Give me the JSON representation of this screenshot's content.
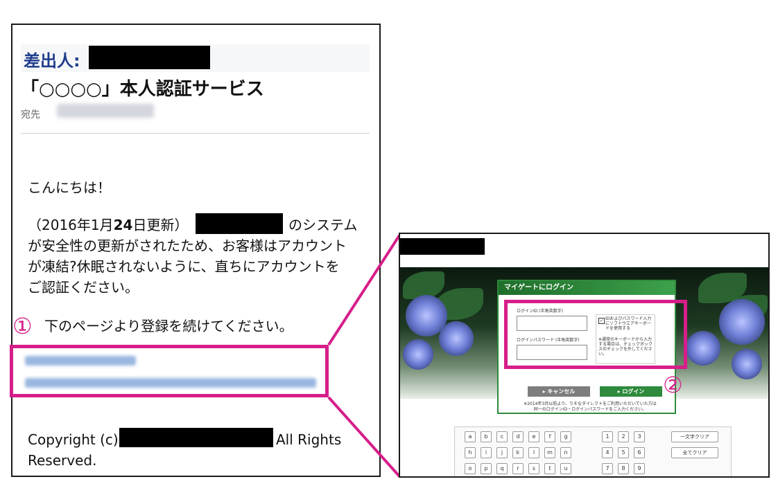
{
  "email": {
    "sender_label": "差出人:【　　　　　】",
    "subject": "「○○○○」本人認証サービス",
    "to_label": "宛先",
    "greeting": "こんにちは！",
    "para1_a": "（2016年1月",
    "para1_b": "24",
    "para1_c": "日更新）",
    "para1_d": "のシステム",
    "para1_line2": "が安全性の更新がされたため、お客様はアカウント",
    "para1_line3": "が凍結?休眠されないように、直ちにアカウントを",
    "para1_line4": "ご認証ください。",
    "instruction": "下のページより登録を続けてください。",
    "copyright_a": "Copyright (c)",
    "copyright_b": "All Rights",
    "copyright_c": "Reserved."
  },
  "annotations": {
    "marker1": "①",
    "marker2": "②",
    "accent_color": "#d61e8a"
  },
  "browser": {
    "login_title": "マイゲートにログイン",
    "id_label": "ログインID",
    "id_hint": "(半角英数字)",
    "pw_label": "ログインパスワード",
    "pw_hint": "(半角英数字)",
    "soft_kb_note": "IDおよびパスワード入力にソフトウエアキーボードを使用する",
    "kb_note": "※通常のキーボードから入力する場合は、チェックボックスのチェックを外してください。",
    "cancel_label": "キャンセル",
    "login_label": "ログイン",
    "notice_1": "※2014年3月以前より、りそなダイレクトをご利用いただいていた方は",
    "notice_2": "同一のログインID・ログインパスワードをご入力ください。",
    "keyboard": {
      "row1": [
        "a",
        "b",
        "c",
        "d",
        "e",
        "f",
        "g"
      ],
      "row2": [
        "h",
        "i",
        "j",
        "k",
        "l",
        "m",
        "n"
      ],
      "row3": [
        "o",
        "p",
        "q",
        "r",
        "s",
        "t",
        "u"
      ],
      "num1": [
        "1",
        "2",
        "3"
      ],
      "num2": [
        "4",
        "5",
        "6"
      ],
      "num3": [
        "7",
        "8",
        "9"
      ],
      "clear_one": "一文字クリア",
      "clear_all": "全てクリア"
    }
  }
}
